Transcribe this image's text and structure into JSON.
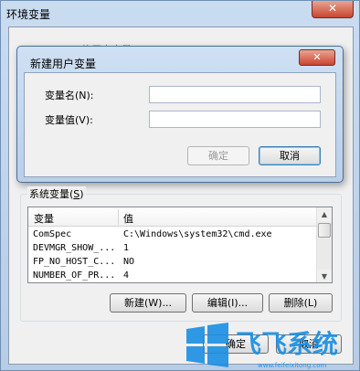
{
  "outer_window": {
    "title": "环境变量",
    "close_glyph": "✕",
    "obscured_text": "tal_i_i_t___ 的用户变量(U)"
  },
  "dialog": {
    "title": "新建用户变量",
    "close_glyph": "✕",
    "name_label": "变量名(N):",
    "name_value": "",
    "value_label": "变量值(V):",
    "value_value": "",
    "ok_label": "确定",
    "cancel_label": "取消"
  },
  "system_vars": {
    "group_label_prefix": "系统变量(",
    "group_label_key": "S",
    "group_label_suffix": ")",
    "columns": [
      "变量",
      "值"
    ],
    "rows": [
      {
        "name": "ComSpec",
        "value": "C:\\Windows\\system32\\cmd.exe"
      },
      {
        "name": "DEVMGR_SHOW_...",
        "value": "1"
      },
      {
        "name": "FP_NO_HOST_C...",
        "value": "NO"
      },
      {
        "name": "NUMBER_OF_PR...",
        "value": "4"
      }
    ],
    "new_label": "新建(W)...",
    "edit_label": "编辑(I)...",
    "delete_label": "删除(L)"
  },
  "bottom": {
    "ok_label": "确定",
    "cancel_label": "取消"
  },
  "watermark": {
    "brand": "飞飞系统",
    "url": "www.feifeixitong.com"
  },
  "colors": {
    "logo_blue": "#1a8fe3",
    "close_red": "#c9452f"
  }
}
